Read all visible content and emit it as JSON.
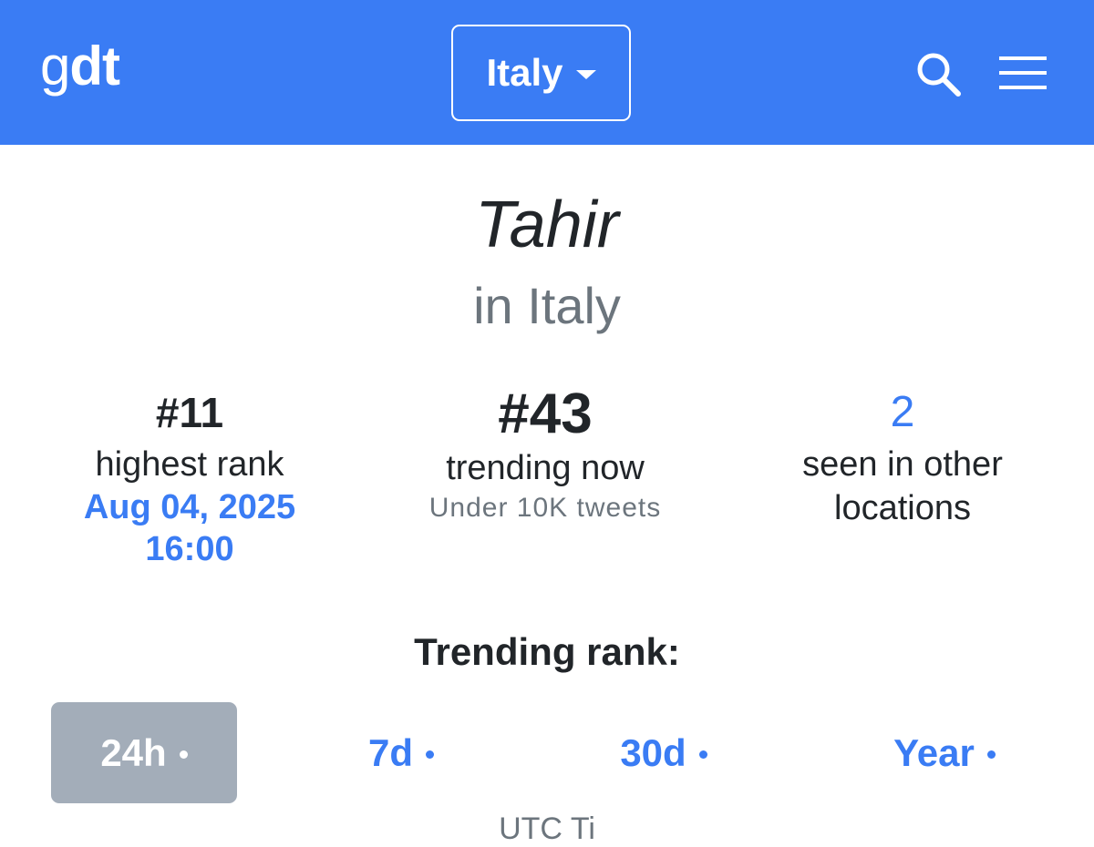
{
  "header": {
    "logo_g": "g",
    "logo_dt": "dt",
    "country": "Italy",
    "icons": [
      "search-icon",
      "menu-icon",
      "caret-down-icon"
    ]
  },
  "topic": {
    "title": "Tahir",
    "location": "in Italy"
  },
  "stats": {
    "highest": {
      "value": "#11",
      "label": "highest rank",
      "date": "Aug 04, 2025",
      "time": "16:00"
    },
    "current": {
      "value": "#43",
      "label": "trending now",
      "volume": "Under 10K tweets"
    },
    "other": {
      "value": "2",
      "label_line1": "seen in other",
      "label_line2": "locations"
    }
  },
  "trending": {
    "title": "Trending rank:",
    "tabs": [
      {
        "label": "24h",
        "active": true
      },
      {
        "label": "7d",
        "active": false
      },
      {
        "label": "30d",
        "active": false
      },
      {
        "label": "Year",
        "active": false
      }
    ],
    "partial_text": "UTC Ti"
  },
  "colors": {
    "accent": "#3a7cf4",
    "active_tab": "#a3adb9",
    "muted": "#6c757d"
  }
}
